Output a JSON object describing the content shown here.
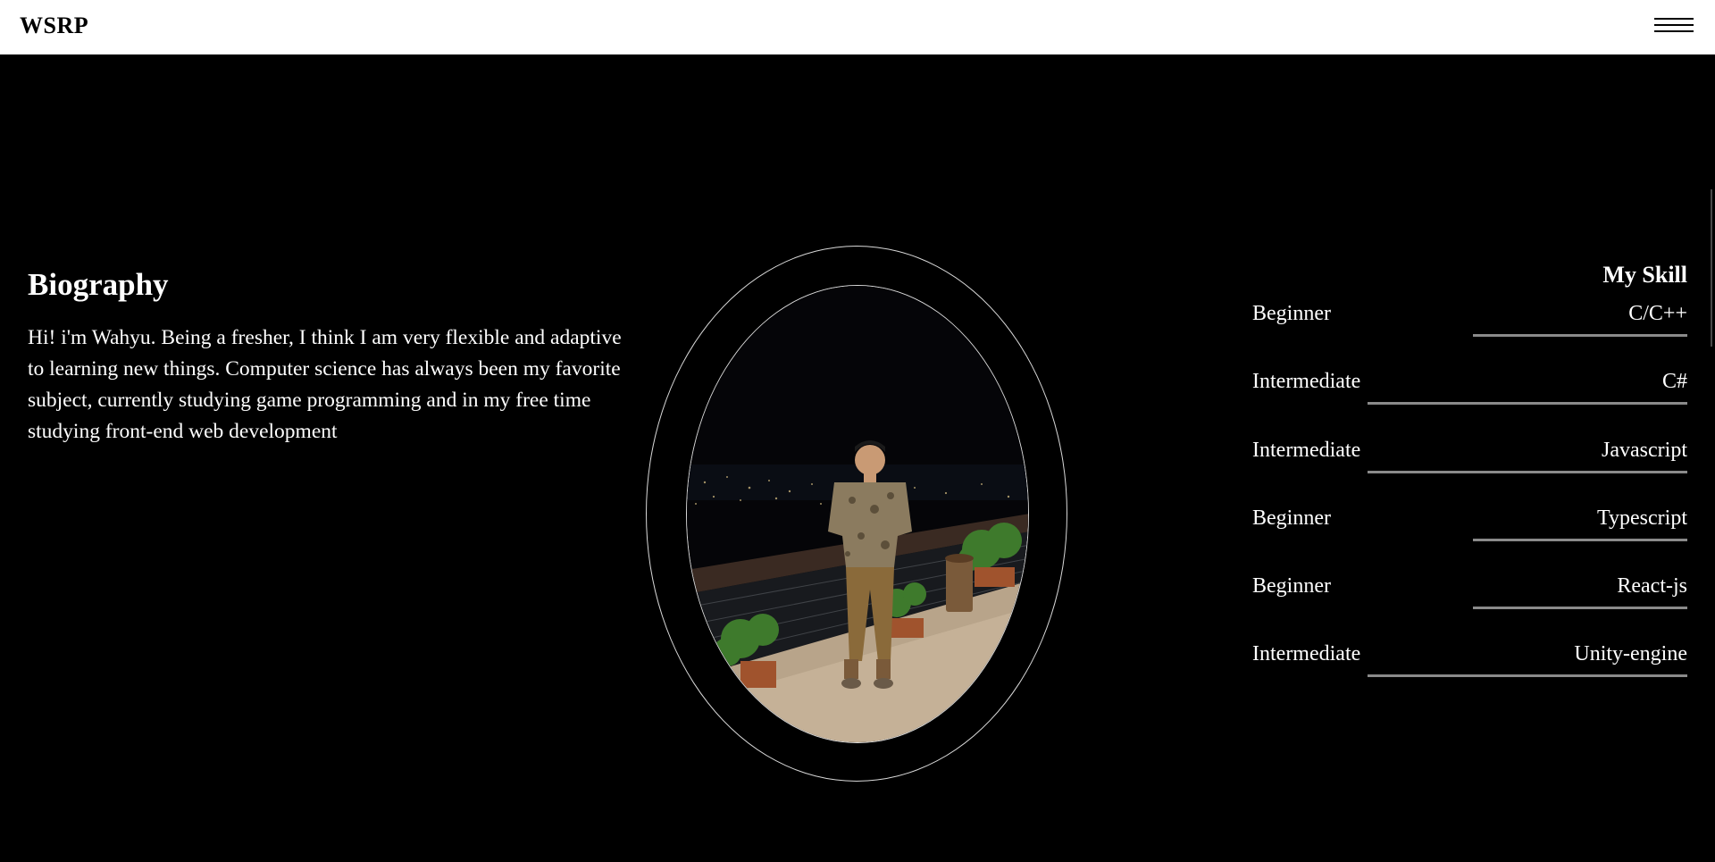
{
  "header": {
    "logo": "WSRP",
    "menu_icon": "hamburger-menu-icon"
  },
  "biography": {
    "title": "Biography",
    "text": "Hi! i'm Wahyu. Being a fresher, I think I am very flexible and adaptive to learning new things. Computer science has always been my favorite subject, currently studying game programming and in my free time studying front-end web development"
  },
  "portrait": {
    "alt": "Portrait photo of Wahyu standing on a balcony at night"
  },
  "skills": {
    "title": "My Skill",
    "items": [
      {
        "level": "Beginner",
        "name": "C/C++",
        "progress": 0.5
      },
      {
        "level": "Intermediate",
        "name": "C#",
        "progress": 0.75
      },
      {
        "level": "Intermediate",
        "name": "Javascript",
        "progress": 0.75
      },
      {
        "level": "Beginner",
        "name": "Typescript",
        "progress": 0.5
      },
      {
        "level": "Beginner",
        "name": "React-js",
        "progress": 0.5
      },
      {
        "level": "Intermediate",
        "name": "Unity-engine",
        "progress": 0.75
      }
    ]
  },
  "colors": {
    "background": "#000000",
    "header_bg": "#ffffff",
    "text": "#ffffff",
    "skill_bar": "#8a8a8a",
    "ring": "#d9d9d9"
  }
}
